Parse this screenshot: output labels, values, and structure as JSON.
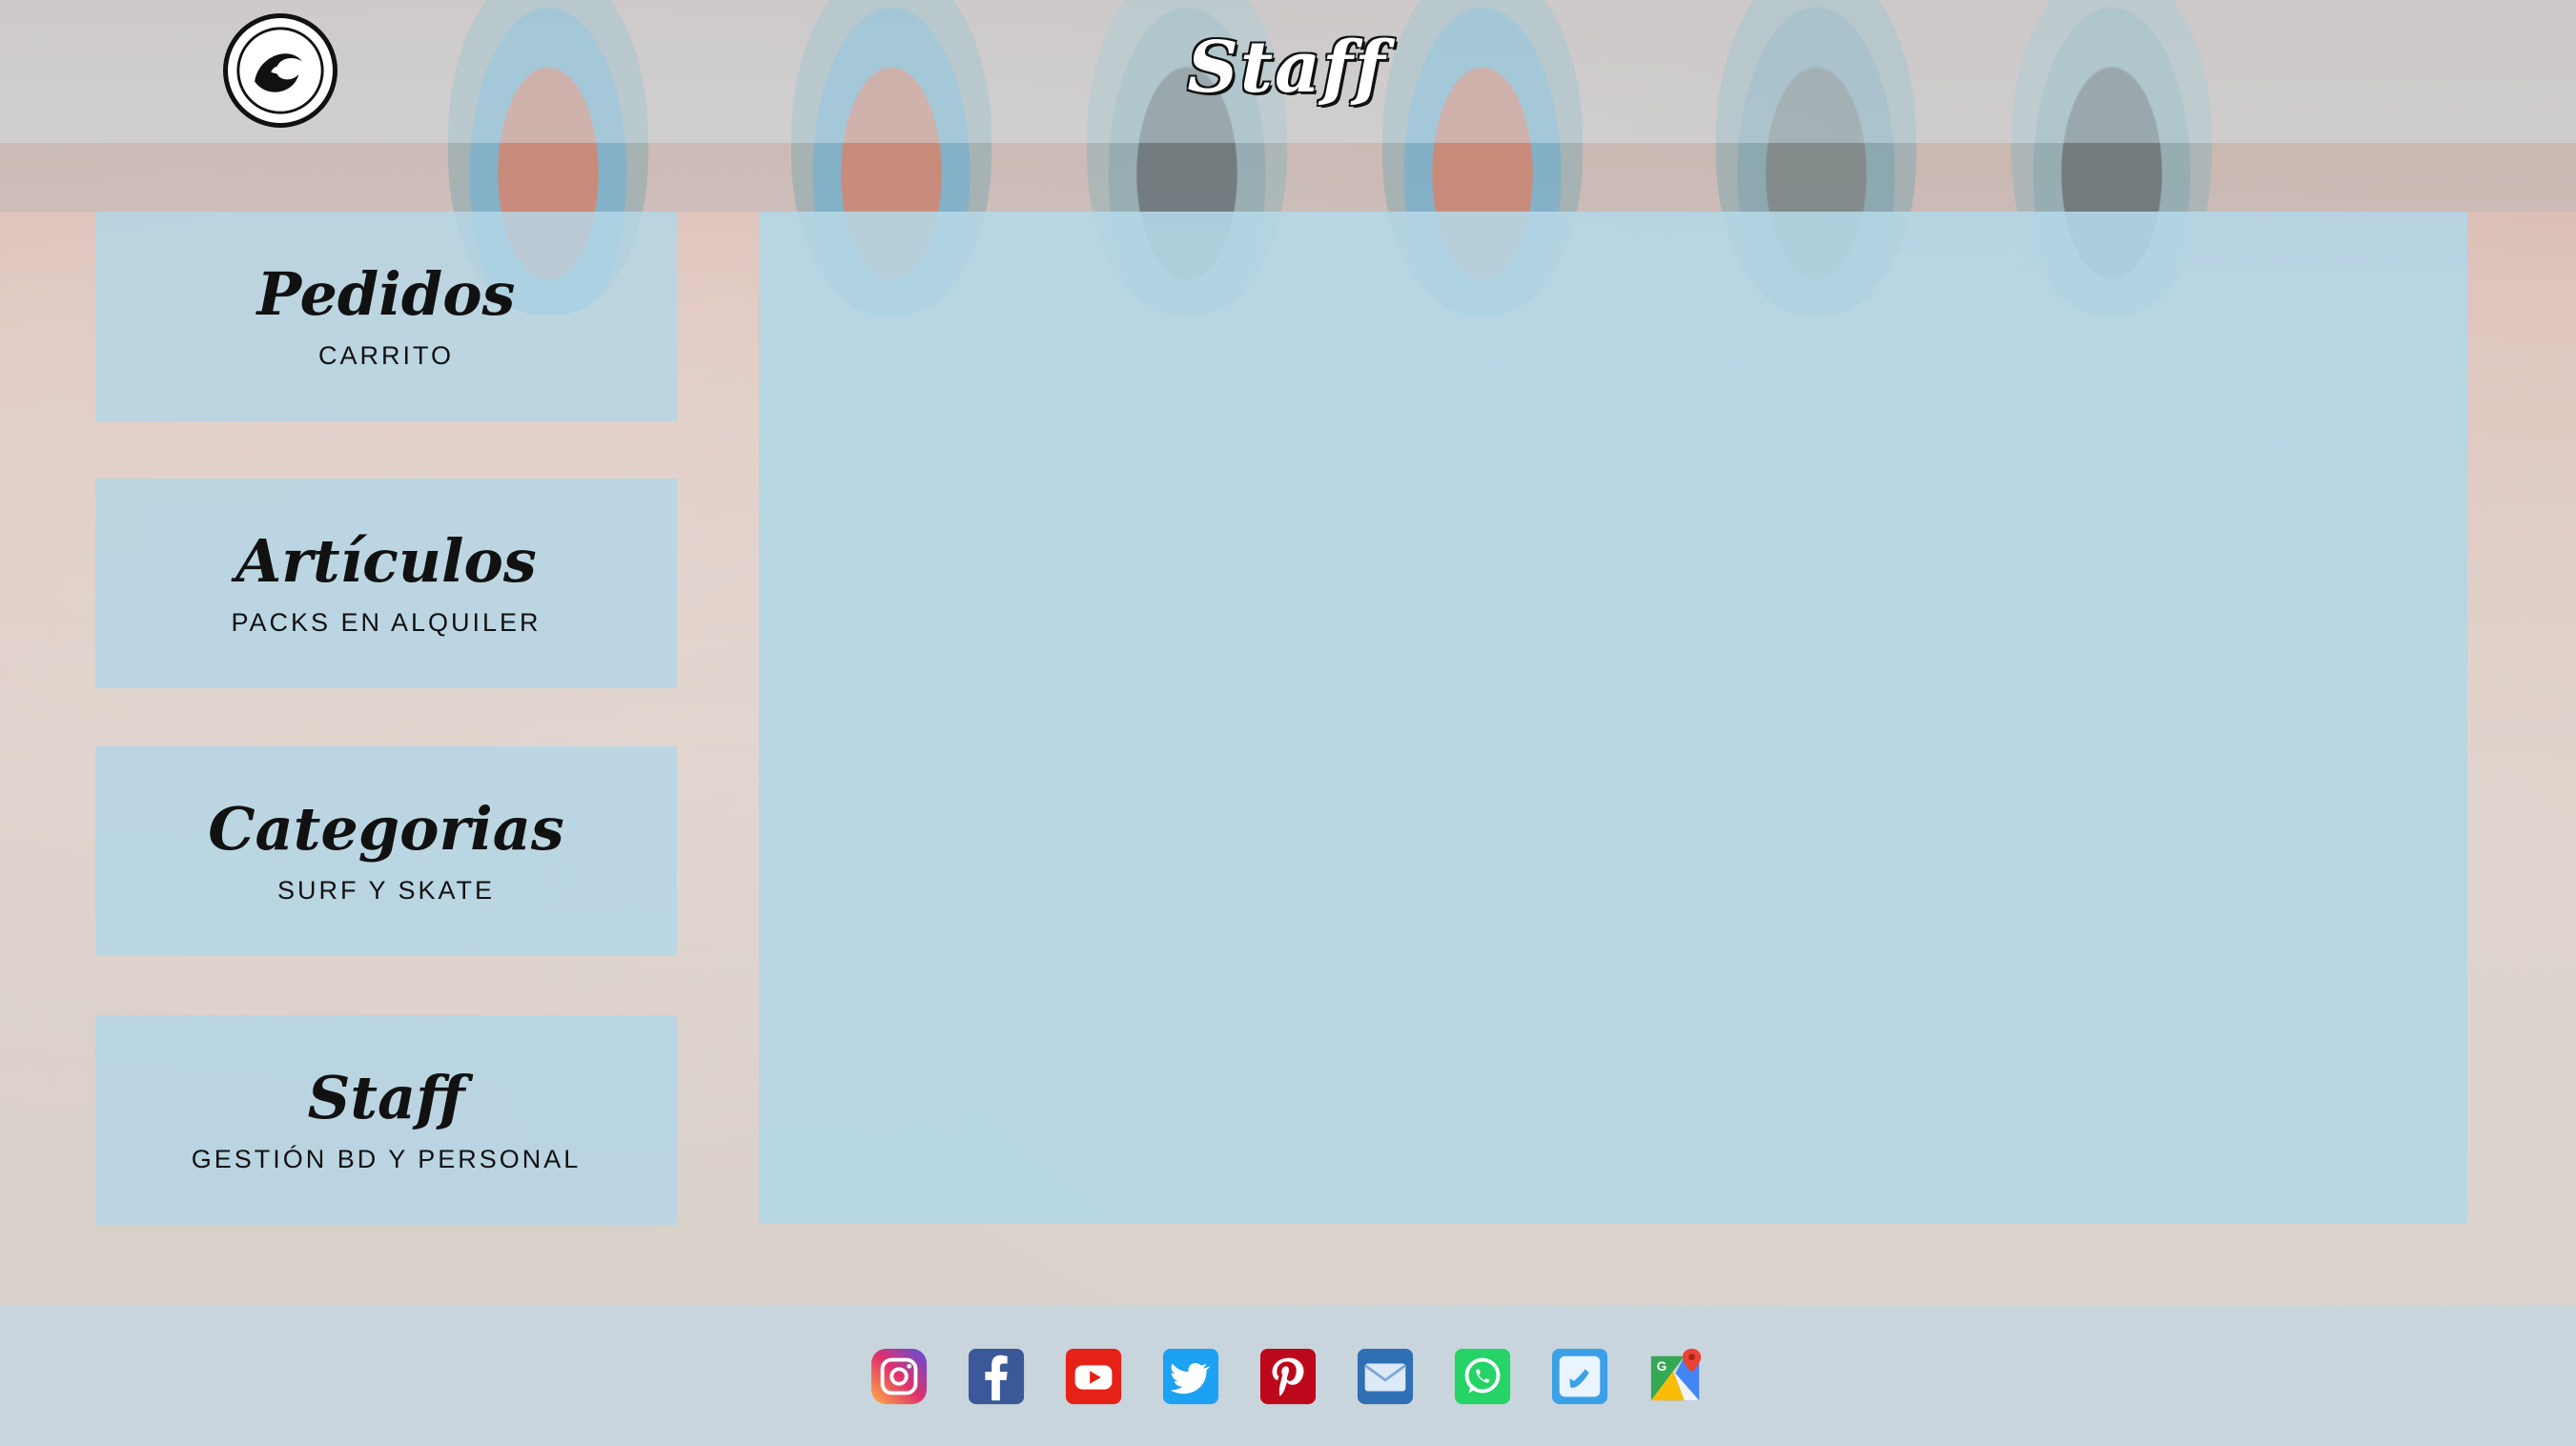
{
  "header": {
    "title": "Staff",
    "logo_icon": "wave-swirl-logo-icon"
  },
  "menu": {
    "items": [
      {
        "title": "Pedidos",
        "subtitle": "CARRITO"
      },
      {
        "title": "Artículos",
        "subtitle": "PACKS EN ALQUILER"
      },
      {
        "title": "Categorias",
        "subtitle": "SURF Y SKATE"
      },
      {
        "title": "Staff",
        "subtitle": "GESTIÓN BD Y PERSONAL"
      }
    ]
  },
  "footer": {
    "social_icons": [
      {
        "name": "instagram-icon",
        "color": "#c13584"
      },
      {
        "name": "facebook-icon",
        "color": "#3b5998"
      },
      {
        "name": "youtube-icon",
        "color": "#ff0000"
      },
      {
        "name": "twitter-icon",
        "color": "#1da1f2"
      },
      {
        "name": "pinterest-icon",
        "color": "#bd081c"
      },
      {
        "name": "mail-icon",
        "color": "#4a90d9"
      },
      {
        "name": "whatsapp-icon",
        "color": "#25d366"
      },
      {
        "name": "phone-icon",
        "color": "#3aa0e8"
      },
      {
        "name": "google-maps-icon",
        "color": "#34a853"
      }
    ]
  },
  "colors": {
    "card_background": "#b4d6e5",
    "footer_background": "#c9d5dc",
    "text": "#111111"
  }
}
